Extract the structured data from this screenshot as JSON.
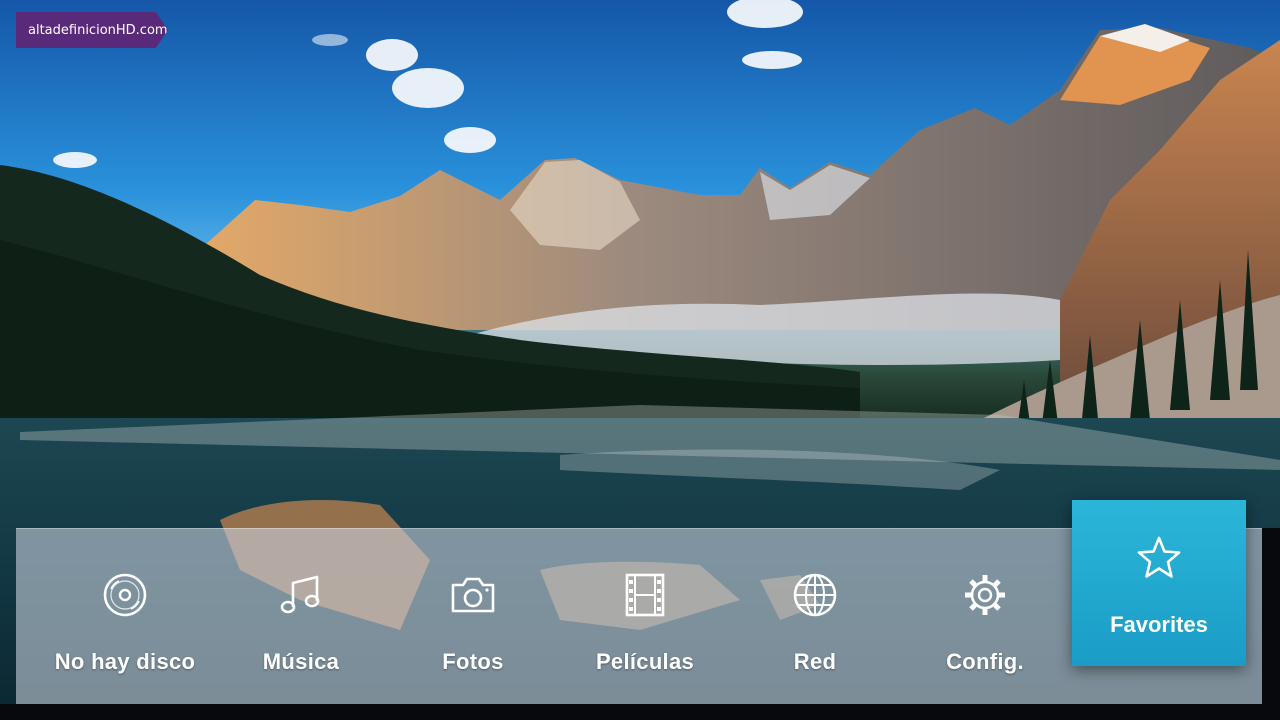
{
  "watermark": {
    "text": "altadefinicionHD.com"
  },
  "menu": {
    "items": [
      {
        "label": "No hay disco",
        "icon": "disc-icon"
      },
      {
        "label": "Música",
        "icon": "music-note-icon"
      },
      {
        "label": "Fotos",
        "icon": "camera-icon"
      },
      {
        "label": "Películas",
        "icon": "film-strip-icon"
      },
      {
        "label": "Red",
        "icon": "globe-icon"
      },
      {
        "label": "Config.",
        "icon": "gear-icon"
      }
    ],
    "selected": {
      "label": "Favorites",
      "icon": "star-icon"
    }
  },
  "colors": {
    "highlight": "#1fa8cf",
    "menu_bar": "#cdd6e2"
  }
}
